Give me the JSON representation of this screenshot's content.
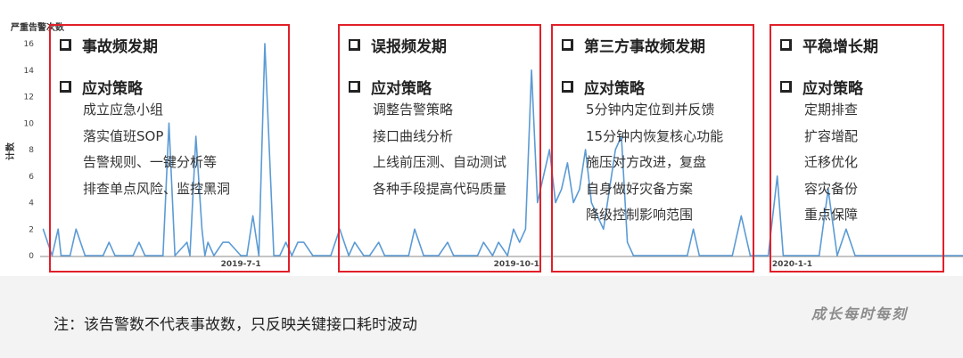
{
  "chart_data": {
    "type": "line",
    "title": "严重告警次数",
    "ylabel": "计数",
    "xlabel": "",
    "ylim": [
      0,
      16
    ],
    "y_ticks": [
      "0",
      "2",
      "4",
      "6",
      "8",
      "10",
      "12",
      "14",
      "16"
    ],
    "x_tick_labels": [
      "2019-7-1",
      "2019-10-1",
      "2020-1-1"
    ],
    "series": [
      {
        "color": "#5b9bd5",
        "x": [
          "2019-04-26",
          "2019-04-29",
          "2019-05-01",
          "2019-05-02",
          "2019-05-05",
          "2019-05-07",
          "2019-05-10",
          "2019-05-16",
          "2019-05-18",
          "2019-05-20",
          "2019-05-26",
          "2019-05-28",
          "2019-05-30",
          "2019-06-05",
          "2019-06-07",
          "2019-06-09",
          "2019-06-13",
          "2019-06-14",
          "2019-06-16",
          "2019-06-18",
          "2019-06-19",
          "2019-06-20",
          "2019-06-22",
          "2019-06-25",
          "2019-06-27",
          "2019-07-01",
          "2019-07-03",
          "2019-07-05",
          "2019-07-07",
          "2019-07-09",
          "2019-07-12",
          "2019-07-14",
          "2019-07-16",
          "2019-07-18",
          "2019-07-20",
          "2019-07-22",
          "2019-07-25",
          "2019-07-28",
          "2019-07-31",
          "2019-08-03",
          "2019-08-06",
          "2019-08-08",
          "2019-08-11",
          "2019-08-13",
          "2019-08-16",
          "2019-08-18",
          "2019-08-21",
          "2019-08-23",
          "2019-08-26",
          "2019-08-28",
          "2019-08-31",
          "2019-09-03",
          "2019-09-05",
          "2019-09-08",
          "2019-09-10",
          "2019-09-13",
          "2019-09-15",
          "2019-09-18",
          "2019-09-20",
          "2019-09-23",
          "2019-09-25",
          "2019-09-28",
          "2019-09-30",
          "2019-10-02",
          "2019-10-04",
          "2019-10-06",
          "2019-10-08",
          "2019-10-10",
          "2019-10-12",
          "2019-10-14",
          "2019-10-16",
          "2019-10-18",
          "2019-10-20",
          "2019-10-22",
          "2019-10-24",
          "2019-10-26",
          "2019-10-28",
          "2019-10-30",
          "2019-11-01",
          "2019-11-03",
          "2019-11-05",
          "2019-11-07",
          "2019-11-09",
          "2019-11-11",
          "2019-11-13",
          "2019-11-15",
          "2019-11-17",
          "2019-11-19",
          "2019-11-21",
          "2019-11-23",
          "2019-11-25",
          "2019-11-27",
          "2019-11-29",
          "2019-12-01",
          "2019-12-03",
          "2019-12-06",
          "2019-12-09",
          "2019-12-12",
          "2019-12-15",
          "2019-12-18",
          "2019-12-21",
          "2019-12-24",
          "2019-12-27",
          "2019-12-29",
          "2020-01-01",
          "2020-01-04",
          "2020-01-07",
          "2020-01-10",
          "2020-01-13",
          "2020-01-16",
          "2020-01-19",
          "2020-01-22",
          "2020-01-26",
          "2020-01-29",
          "2020-02-01",
          "2020-02-04",
          "2020-02-07",
          "2020-02-10",
          "2020-02-13",
          "2020-02-16",
          "2020-02-19",
          "2020-02-22"
        ],
        "values": [
          2,
          0,
          2,
          0,
          0,
          2,
          0,
          0,
          1,
          0,
          0,
          1,
          0,
          0,
          10,
          0,
          1,
          0,
          9,
          2,
          0,
          1,
          0,
          1,
          1,
          0,
          0,
          3,
          0,
          16,
          0,
          0,
          1,
          0,
          1,
          1,
          0,
          0,
          0,
          2,
          0,
          1,
          0,
          0,
          1,
          0,
          0,
          0,
          0,
          2,
          0,
          0,
          0,
          1,
          0,
          0,
          0,
          0,
          1,
          0,
          1,
          0,
          2,
          1,
          2,
          14,
          4,
          6,
          8,
          4,
          5,
          7,
          4,
          5,
          8,
          4,
          3,
          2,
          5,
          8,
          9,
          1,
          0,
          0,
          0,
          0,
          0,
          0,
          0,
          0,
          0,
          0,
          2,
          0,
          0,
          0,
          0,
          0,
          3,
          0,
          0,
          0,
          6,
          0,
          0,
          0,
          0,
          0,
          5,
          0,
          2,
          0,
          0,
          0,
          0,
          0,
          0,
          0,
          0,
          0,
          0,
          0
        ]
      }
    ]
  },
  "phases": [
    {
      "title": "事故频发期",
      "strategy_label": "应对策略",
      "items": [
        "成立应急小组",
        "落实值班SOP",
        "告警规则、一键分析等",
        "排查单点风险、监控黑洞"
      ]
    },
    {
      "title": "误报频发期",
      "strategy_label": "应对策略",
      "items": [
        "调整告警策略",
        "接口曲线分析",
        "上线前压测、自动测试",
        "各种手段提高代码质量"
      ]
    },
    {
      "title": "第三方事故频发期",
      "strategy_label": "应对策略",
      "items": [
        "5分钟内定位到并反馈",
        "15分钟内恢复核心功能",
        "施压对方改进，复盘",
        "自身做好灾备方案",
        "降级控制影响范围"
      ]
    },
    {
      "title": "平稳增长期",
      "strategy_label": "应对策略",
      "items": [
        "定期排查",
        "扩容增配",
        "迁移优化",
        "容灾备份",
        "重点保障"
      ]
    }
  ],
  "footer": {
    "note": "注：该告警数不代表事故数，只反映关键接口耗时波动",
    "watermark": "成长每时每刻"
  }
}
